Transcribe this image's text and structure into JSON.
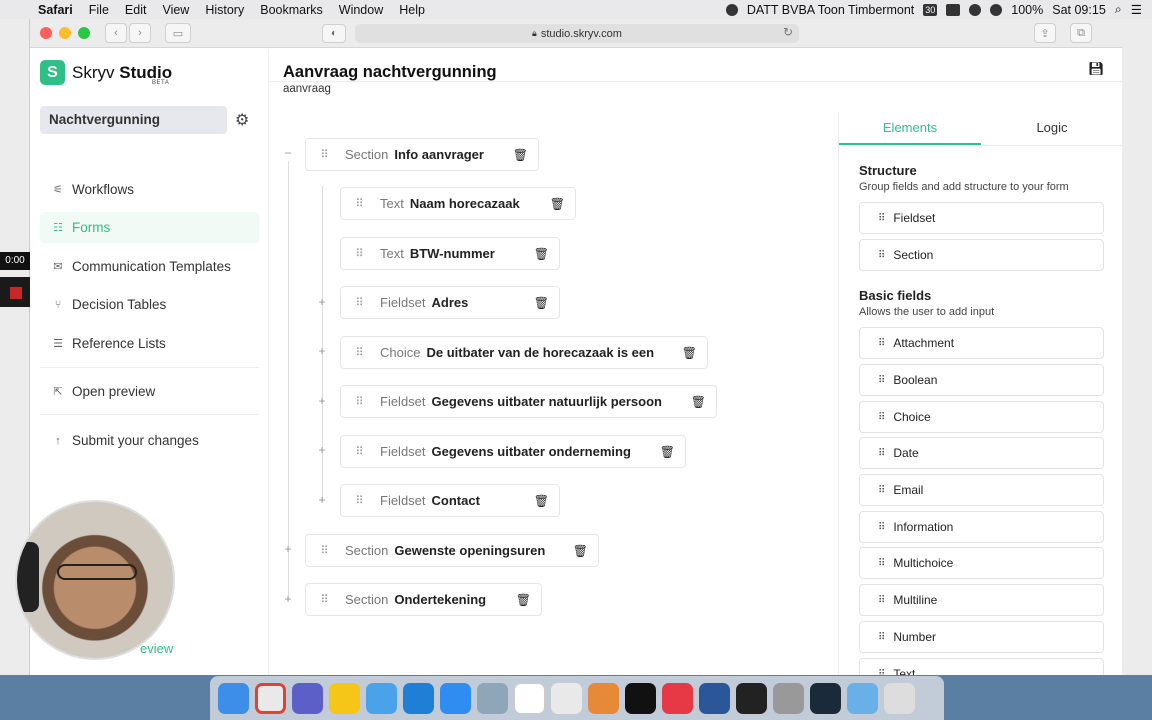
{
  "menubar": {
    "apple": "",
    "items": [
      "Safari",
      "File",
      "Edit",
      "View",
      "History",
      "Bookmarks",
      "Window",
      "Help"
    ],
    "status_text": "DATT BVBA Toon Timbermont",
    "calendar_day": "30",
    "battery": "100%",
    "clock": "Sat 09:15"
  },
  "browser": {
    "url": "studio.skryv.com"
  },
  "recording": {
    "timer": "0:00"
  },
  "app": {
    "logo_letter": "S",
    "brand_light": "Skryv ",
    "brand_bold": "Studio",
    "beta": "BETA",
    "project": "Nachtvergunning",
    "nav": [
      {
        "icon": "workflows-icon",
        "label": "Workflows"
      },
      {
        "icon": "forms-icon",
        "label": "Forms"
      },
      {
        "icon": "mail-icon",
        "label": "Communication Templates"
      },
      {
        "icon": "decision-icon",
        "label": "Decision Tables"
      },
      {
        "icon": "list-icon",
        "label": "Reference Lists"
      },
      {
        "icon": "external-link-icon",
        "label": "Open preview"
      },
      {
        "icon": "arrow-up-icon",
        "label": "Submit your changes"
      }
    ],
    "ghost_text": "eview"
  },
  "form": {
    "title": "Aanvraag nachtvergunning",
    "subtitle": "aanvraag",
    "nodes": [
      {
        "kind": "Section",
        "name": "Info aanvrager"
      },
      {
        "kind": "Text",
        "name": "Naam horecazaak"
      },
      {
        "kind": "Text",
        "name": "BTW-nummer"
      },
      {
        "kind": "Fieldset",
        "name": "Adres"
      },
      {
        "kind": "Choice",
        "name": "De uitbater van de horecazaak is een"
      },
      {
        "kind": "Fieldset",
        "name": "Gegevens uitbater natuurlijk persoon"
      },
      {
        "kind": "Fieldset",
        "name": "Gegevens uitbater onderneming"
      },
      {
        "kind": "Fieldset",
        "name": "Contact"
      },
      {
        "kind": "Section",
        "name": "Gewenste openingsuren"
      },
      {
        "kind": "Section",
        "name": "Ondertekening"
      }
    ]
  },
  "panel": {
    "tabs": [
      "Elements",
      "Logic"
    ],
    "structure_title": "Structure",
    "structure_desc": "Group fields and add structure to your form",
    "structure_items": [
      "Fieldset",
      "Section"
    ],
    "basic_title": "Basic fields",
    "basic_desc": "Allows the user to add input",
    "basic_items": [
      "Attachment",
      "Boolean",
      "Choice",
      "Date",
      "Email",
      "Information",
      "Multichoice",
      "Multiline",
      "Number",
      "Text"
    ]
  },
  "colors": {
    "accent": "#2fbf88"
  }
}
